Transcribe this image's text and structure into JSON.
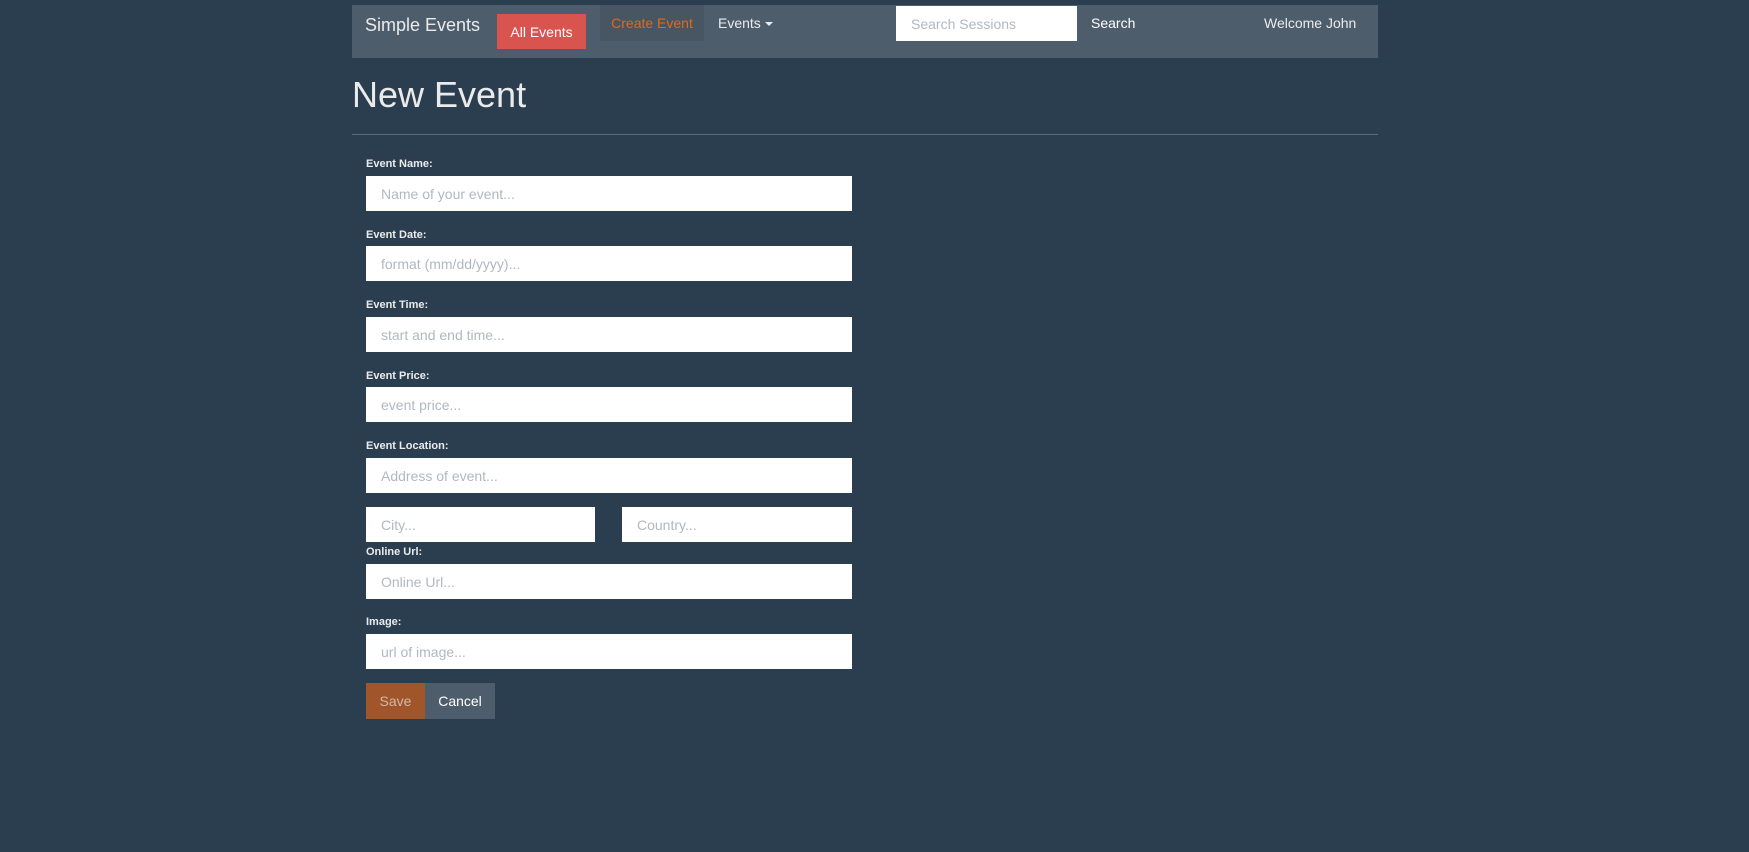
{
  "navbar": {
    "brand": "Simple Events",
    "all_events": "All Events",
    "create_event": "Create Event",
    "events_menu": "Events",
    "search_placeholder": "Search Sessions",
    "search_button": "Search",
    "welcome": "Welcome John"
  },
  "page": {
    "title": "New Event"
  },
  "form": {
    "event_name": {
      "label": "Event Name:",
      "placeholder": "Name of your event..."
    },
    "event_date": {
      "label": "Event Date:",
      "placeholder": "format (mm/dd/yyyy)..."
    },
    "event_time": {
      "label": "Event Time:",
      "placeholder": "start and end time..."
    },
    "event_price": {
      "label": "Event Price:",
      "placeholder": "event price..."
    },
    "event_location": {
      "label": "Event Location:",
      "placeholder": "Address of event..."
    },
    "city": {
      "placeholder": "City..."
    },
    "country": {
      "placeholder": "Country..."
    },
    "online_url": {
      "label": "Online Url:",
      "placeholder": "Online Url..."
    },
    "image": {
      "label": "Image:",
      "placeholder": "url of image..."
    },
    "save_label": "Save",
    "cancel_label": "Cancel"
  },
  "colors": {
    "background": "#2b3e50",
    "navbar": "#4e5d6c",
    "danger": "#d9534f",
    "accent": "#df691a",
    "save": "#a0552a"
  }
}
